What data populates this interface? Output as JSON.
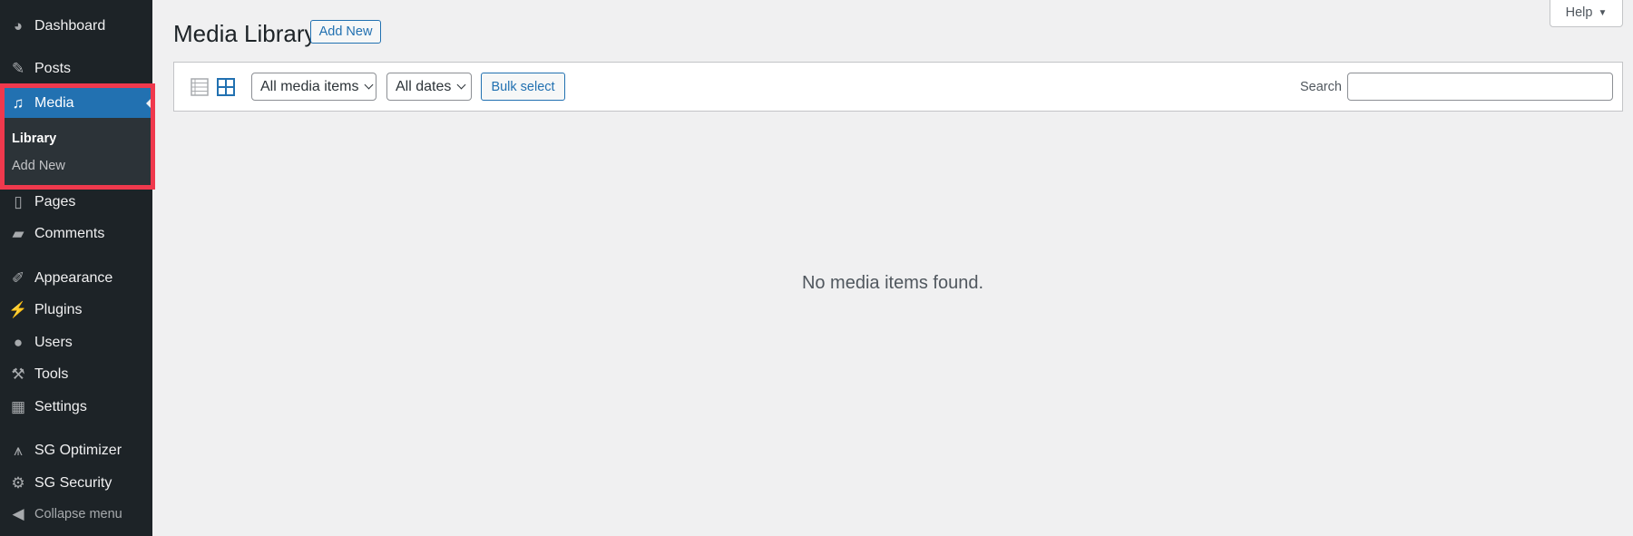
{
  "sidebar": {
    "items": [
      {
        "label": "Dashboard",
        "icon": "dashboard-icon",
        "glyph": "◕"
      },
      {
        "label": "Posts",
        "icon": "pin-icon",
        "glyph": "✎"
      },
      {
        "label": "Media",
        "icon": "media-icon",
        "glyph": "♫"
      },
      {
        "label": "Pages",
        "icon": "pages-icon",
        "glyph": "▯"
      },
      {
        "label": "Comments",
        "icon": "comment-icon",
        "glyph": "▰"
      },
      {
        "label": "Appearance",
        "icon": "paintbrush-icon",
        "glyph": "✐"
      },
      {
        "label": "Plugins",
        "icon": "plug-icon",
        "glyph": "⚡"
      },
      {
        "label": "Users",
        "icon": "user-icon",
        "glyph": "●"
      },
      {
        "label": "Tools",
        "icon": "wrench-icon",
        "glyph": "⚒"
      },
      {
        "label": "Settings",
        "icon": "settings-icon",
        "glyph": "▦"
      },
      {
        "label": "SG Optimizer",
        "icon": "sg-optimizer-icon",
        "glyph": "⩚"
      },
      {
        "label": "SG Security",
        "icon": "gear-lock-icon",
        "glyph": "⚙"
      }
    ],
    "submenu": {
      "library": "Library",
      "add_new": "Add New"
    },
    "collapse": {
      "label": "Collapse menu",
      "glyph": "◀"
    }
  },
  "header": {
    "title": "Media Library",
    "add_new": "Add New",
    "help": "Help",
    "help_glyph": "▼"
  },
  "toolbar": {
    "filter_type": "All media items",
    "filter_date": "All dates",
    "bulk_select": "Bulk select",
    "search_label": "Search",
    "search_value": ""
  },
  "main": {
    "empty_message": "No media items found."
  },
  "colors": {
    "sidebar": "#1d2327",
    "accent": "#2271b1",
    "highlight": "#f0394d"
  }
}
